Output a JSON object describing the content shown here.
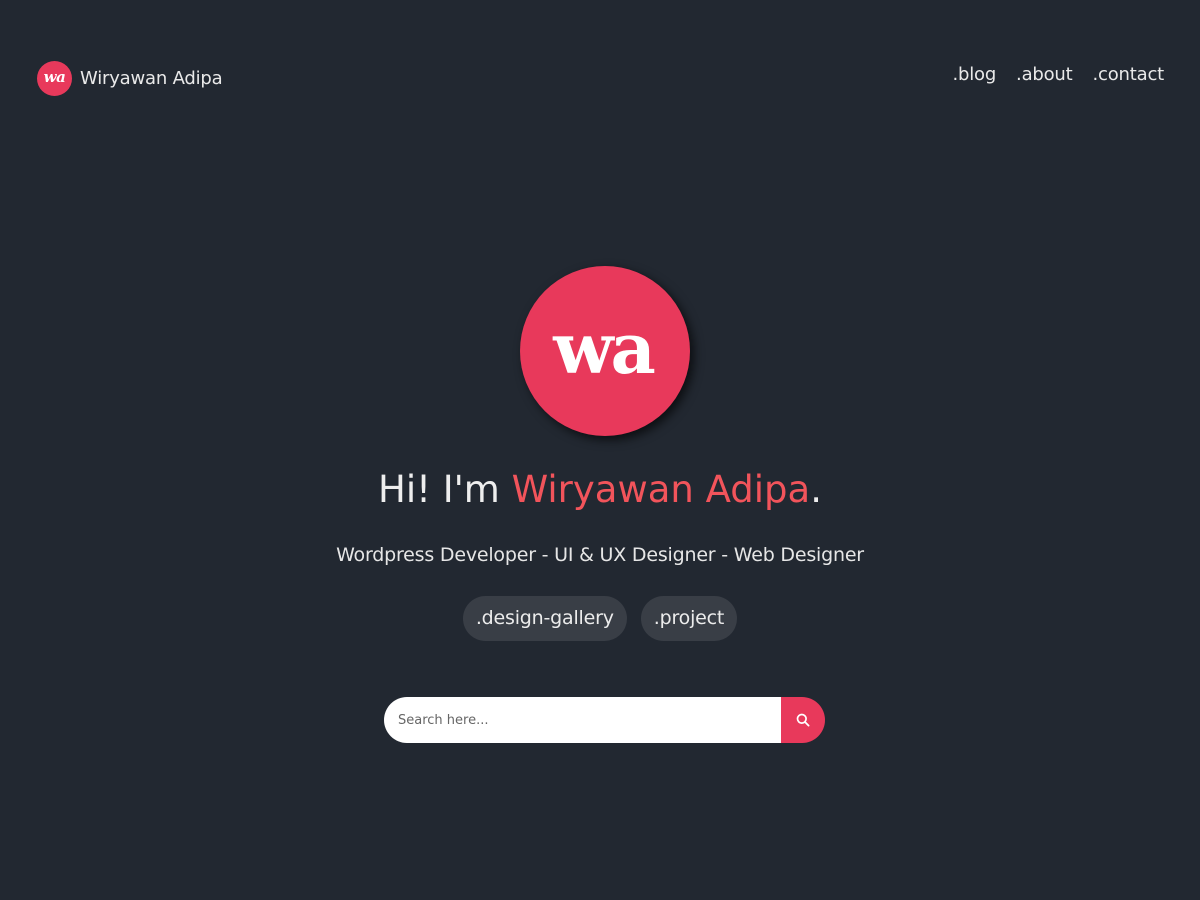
{
  "header": {
    "logo_text": "wa",
    "brand_name": "Wiryawan Adipa",
    "nav": [
      {
        "label": ".blog"
      },
      {
        "label": ".about"
      },
      {
        "label": ".contact"
      }
    ]
  },
  "hero": {
    "logo_text": "wa",
    "title_prefix": "Hi! I'm ",
    "title_name": "Wiryawan Adipa",
    "title_suffix": ".",
    "subtitle": "Wordpress Developer - UI & UX Designer - Web Designer",
    "tags": [
      {
        "label": ".design-gallery"
      },
      {
        "label": ".project"
      }
    ]
  },
  "search": {
    "placeholder": "Search here...",
    "button_icon": "search-icon"
  },
  "colors": {
    "background": "#222831",
    "accent": "#e8395b",
    "accent_text": "#f2545b",
    "tag_background": "#393e46"
  }
}
